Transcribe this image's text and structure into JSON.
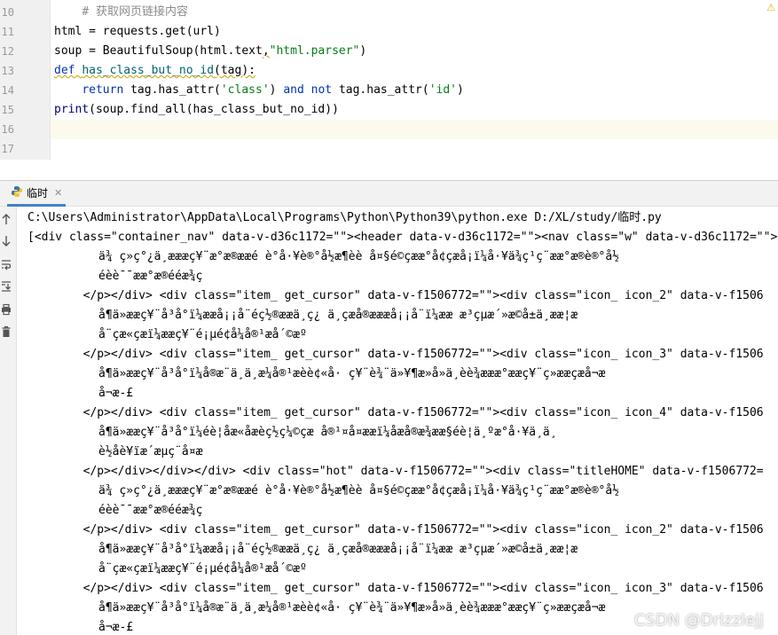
{
  "editor": {
    "lines": [
      {
        "num": "10",
        "parts": [
          {
            "t": "    ",
            "c": ""
          },
          {
            "t": "# 获取网页链接内容",
            "c": "comment"
          }
        ]
      },
      {
        "num": "11",
        "parts": [
          {
            "t": "html = requests.get(url)",
            "c": ""
          }
        ]
      },
      {
        "num": "12",
        "parts": [
          {
            "t": "soup = BeautifulSoup(html.text",
            "c": ""
          },
          {
            "t": ",",
            "c": "squiggle"
          },
          {
            "t": "\"html.parser\"",
            "c": "str"
          },
          {
            "t": ")",
            "c": ""
          }
        ]
      },
      {
        "num": "13",
        "parts": [
          {
            "t": "def ",
            "c": "kw squiggle"
          },
          {
            "t": "has_class_but_no_id",
            "c": "fn squiggle"
          },
          {
            "t": "(tag):",
            "c": "squiggle"
          }
        ]
      },
      {
        "num": "14",
        "parts": [
          {
            "t": "    ",
            "c": ""
          },
          {
            "t": "return ",
            "c": "kw"
          },
          {
            "t": "tag.has_attr(",
            "c": ""
          },
          {
            "t": "'class'",
            "c": "str"
          },
          {
            "t": ") ",
            "c": ""
          },
          {
            "t": "and not ",
            "c": "kw"
          },
          {
            "t": "tag.has_attr(",
            "c": ""
          },
          {
            "t": "'id'",
            "c": "str"
          },
          {
            "t": ")",
            "c": ""
          }
        ]
      },
      {
        "num": "15",
        "parts": [
          {
            "t": "print",
            "c": "builtin"
          },
          {
            "t": "(soup.find_all(has_class_but_no_id))",
            "c": ""
          }
        ]
      },
      {
        "num": "16",
        "parts": []
      },
      {
        "num": "17",
        "parts": []
      }
    ],
    "warning_glyph": "⚠"
  },
  "run": {
    "tab_label": "临时",
    "close_glyph": "✕",
    "tools": [
      "rerun-up-icon",
      "scroll-down-icon",
      "soft-wrap-icon",
      "scroll-to-end-icon",
      "print-icon",
      "trash-icon"
    ],
    "console_lines": [
      {
        "indent": 0,
        "text": "C:\\Users\\Administrator\\AppData\\Local\\Programs\\Python\\Python39\\python.exe D:/XL/study/临时.py"
      },
      {
        "indent": 0,
        "text": "[<div class=\"container_nav\" data-v-d36c1172=\"\"><header data-v-d36c1172=\"\"><nav class=\"w\" data-v-d36c1172=\"\"><"
      },
      {
        "indent": 1,
        "text": "ä¾ ç»ç°¿ä¸æææç¥¨æ°æ®ææé è°å·¥è®°å½æ¶èè å¤§é©çææ°å¢çæå¡ï¼å·¥ä¾ç¹ç¨ææ°æ®è®°å½"
      },
      {
        "indent": 1,
        "text": "éèè¯¯ææ°æ®ééæ¾ç"
      },
      {
        "indent": 0,
        "text": "        </p></div> <div class=\"item_ get_cursor\" data-v-f1506772=\"\"><div class=\"icon_ icon_2\" data-v-f1506"
      },
      {
        "indent": 1,
        "text": "å¶ä»ææç¥¨å³å°ï¼ææå¡¡å¨éç½®ææä¸ç¿ ä¸çæå®æææå¡¡å¨ï¼ææ æ³çµæ´»æ©å±ä¸ææ¦æ"
      },
      {
        "indent": 1,
        "text": "å¨çæ«çæï¼ææç¥¨é¡µé¢å¼å®¹æå´©æº"
      },
      {
        "indent": 0,
        "text": "        </p></div> <div class=\"item_ get_cursor\" data-v-f1506772=\"\"><div class=\"icon_ icon_3\" data-v-f1506"
      },
      {
        "indent": 1,
        "text": "å¶ä»ææç¥¨å³å°ï¼å®æ¨ä¸ä¸æ¼å®¹æèè¢«å· ç¥¨è¾¨ä»¥¶æ»å»ä¸èè¾æææ°ææç¥¨ç»ææçæå¬æ"
      },
      {
        "indent": 1,
        "text": "å¬æ-£"
      },
      {
        "indent": 0,
        "text": "        </p></div> <div class=\"item_ get_cursor\" data-v-f1506772=\"\"><div class=\"icon_ icon_4\" data-v-f1506"
      },
      {
        "indent": 1,
        "text": "å¶ä»ææç¥¨å³å°ï¼éè¦åæ«åæèç½ç¼©çæ å®¹¤å¤ææï¼åæå®æ¾ææ§éè¦ä¸ºæ°å·¥ä¸ä¸"
      },
      {
        "indent": 1,
        "text": "è½åè¥ïæ´æµç¨å¤æ"
      },
      {
        "indent": 0,
        "text": "        </p></div></div></div> <div class=\"hot\" data-v-f1506772=\"\"><div class=\"titleHOME\" data-v-f1506772="
      },
      {
        "indent": 1,
        "text": "ä¾ ç»ç°¿ä¸æææç¥¨æ°æ®ææé è°å·¥è®°å½æ¶èè å¤§é©çææ°å¢çæå¡ï¼å·¥ä¾ç¹ç¨ææ°æ®è®°å½"
      },
      {
        "indent": 1,
        "text": "éèè¯¯ææ°æ®ééæ¾ç"
      },
      {
        "indent": 0,
        "text": "        </p></div> <div class=\"item_ get_cursor\" data-v-f1506772=\"\"><div class=\"icon_ icon_2\" data-v-f1506"
      },
      {
        "indent": 1,
        "text": "å¶ä»ææç¥¨å³å°ï¼ææå¡¡å¨éç½®ææä¸ç¿ ä¸çæå®æææå¡¡å¨ï¼ææ æ³çµæ´»æ©å±ä¸ææ¦æ"
      },
      {
        "indent": 1,
        "text": "å¨çæ«çæï¼ææç¥¨é¡µé¢å¼å®¹æå´©æº"
      },
      {
        "indent": 0,
        "text": "        </p></div> <div class=\"item_ get_cursor\" data-v-f1506772=\"\"><div class=\"icon_ icon_3\" data-v-f1506"
      },
      {
        "indent": 1,
        "text": "å¶ä»ææç¥¨å³å°ï¼å®æ¨ä¸ä¸æ¼å®¹æèè¢«å· ç¥¨è¾¨ä»¥¶æ»å»ä¸èè¾æææ°ææç¥¨ç»ææçæå¬æ"
      },
      {
        "indent": 1,
        "text": "å¬æ-£"
      }
    ],
    "watermark": "CSDN @Drizzlejj"
  }
}
